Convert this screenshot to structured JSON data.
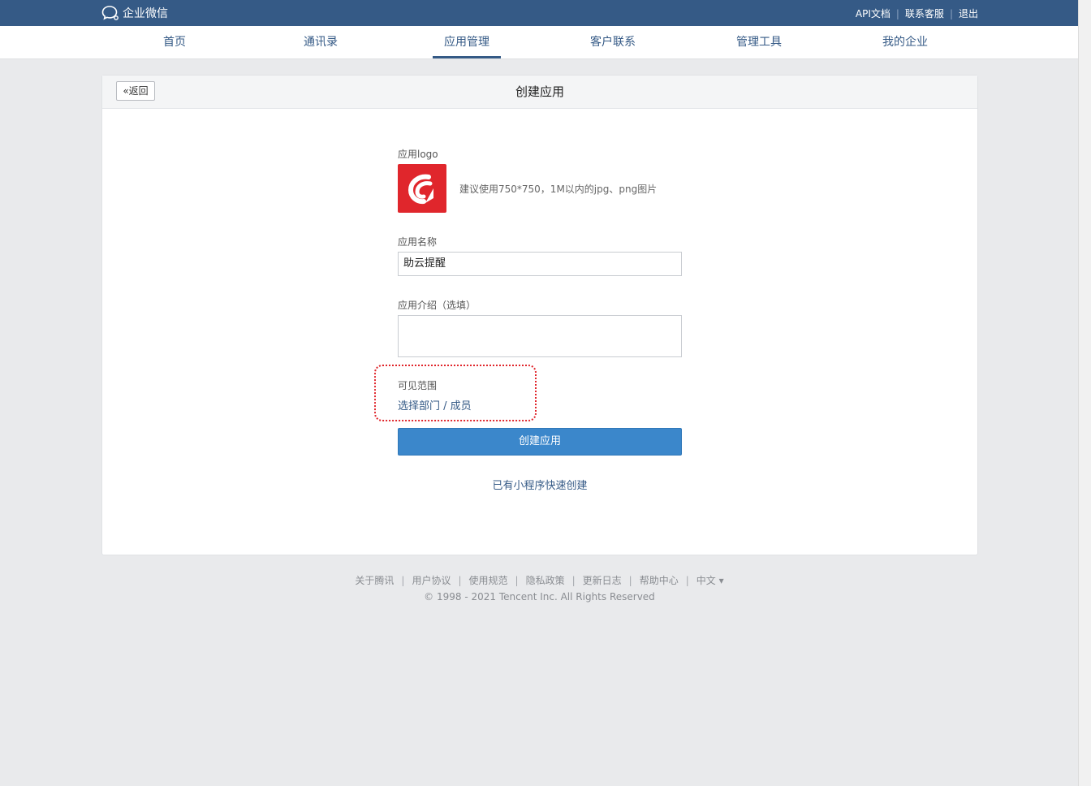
{
  "header": {
    "brand": "企业微信",
    "links": [
      "API文档",
      "联系客服",
      "退出"
    ]
  },
  "nav": {
    "tabs": [
      "首页",
      "通讯录",
      "应用管理",
      "客户联系",
      "管理工具",
      "我的企业"
    ],
    "active": "应用管理"
  },
  "page": {
    "back_label": "返回",
    "title": "创建应用"
  },
  "form": {
    "logo_label": "应用logo",
    "logo_hint": "建议使用750*750，1M以内的jpg、png图片",
    "name_label": "应用名称",
    "name_value": "助云提醒",
    "intro_label": "应用介绍（选填）",
    "scope_label": "可见范围",
    "scope_link": "选择部门 / 成员",
    "create_button": "创建应用",
    "quick_create": "已有小程序快速创建"
  },
  "footer": {
    "links": [
      "关于腾讯",
      "用户协议",
      "使用规范",
      "隐私政策",
      "更新日志",
      "帮助中心",
      "中文 ▾"
    ],
    "copyright": "© 1998 - 2021 Tencent Inc. All Rights Reserved"
  },
  "colors": {
    "header_bg": "#355a86",
    "accent_blue": "#3b87cb",
    "logo_red": "#e0262c",
    "highlight_red": "#e0262c"
  }
}
